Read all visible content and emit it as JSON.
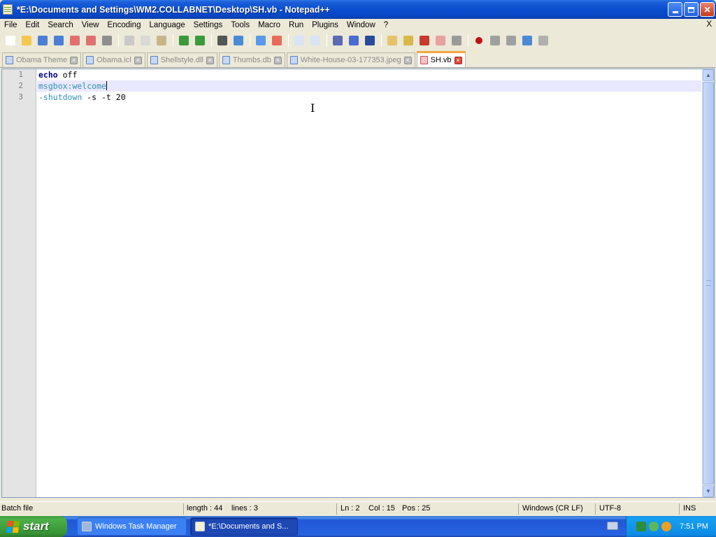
{
  "window": {
    "title": "*E:\\Documents and Settings\\WM2.COLLABNET\\Desktop\\SH.vb - Notepad++"
  },
  "menu": {
    "items": [
      "File",
      "Edit",
      "Search",
      "View",
      "Encoding",
      "Language",
      "Settings",
      "Tools",
      "Macro",
      "Run",
      "Plugins",
      "Window",
      "?"
    ],
    "close_label": "X"
  },
  "toolbar": {
    "icons": [
      "new-file-icon",
      "open-file-icon",
      "save-icon",
      "save-all-icon",
      "close-icon",
      "close-all-icon",
      "print-icon",
      "cut-icon",
      "copy-icon",
      "paste-icon",
      "undo-icon",
      "redo-icon",
      "find-icon",
      "replace-icon",
      "zoom-in-icon",
      "zoom-out-icon",
      "sync-v-icon",
      "sync-h-icon",
      "word-wrap-icon",
      "show-all-chars-icon",
      "indent-guide-icon",
      "user-lang-icon",
      "doc-map-icon",
      "function-list-icon",
      "folder-workspace-icon",
      "monitor-icon",
      "record-macro-icon",
      "stop-macro-icon",
      "play-macro-icon",
      "run-macro-multiple-icon",
      "save-macro-icon"
    ]
  },
  "tabs": [
    {
      "label": "Obama Theme",
      "active": false
    },
    {
      "label": "Obama.icl",
      "active": false
    },
    {
      "label": "Shellstyle.dll",
      "active": false
    },
    {
      "label": "Thumbs.db",
      "active": false
    },
    {
      "label": "White-House-03-177353.jpeg",
      "active": false
    },
    {
      "label": "SH.vb",
      "active": true
    }
  ],
  "editor": {
    "line_numbers": [
      "1",
      "2",
      "3"
    ],
    "lines": [
      {
        "keyword": "echo",
        "rest": " off"
      },
      {
        "label": "msgbox:welcome"
      },
      {
        "command": "-shutdown",
        "rest": " -s -t 20"
      }
    ],
    "current_line": 2
  },
  "status": {
    "file_type": "Batch file",
    "length": "length : 44",
    "lines": "lines : 3",
    "ln": "Ln : 2",
    "col": "Col : 15",
    "pos": "Pos : 25",
    "eol": "Windows (CR LF)",
    "encoding": "UTF-8",
    "mode": "INS"
  },
  "taskbar": {
    "start_label": "start",
    "tasks": [
      {
        "label": "Windows Task Manager"
      },
      {
        "label": "*E:\\Documents and S..."
      }
    ],
    "clock": "7:51 PM"
  },
  "colors": {
    "keyword": "#000080",
    "label": "#3090b8",
    "current_line_bg": "#e8e8ff",
    "active_tab_accent": "#f3a63c"
  }
}
